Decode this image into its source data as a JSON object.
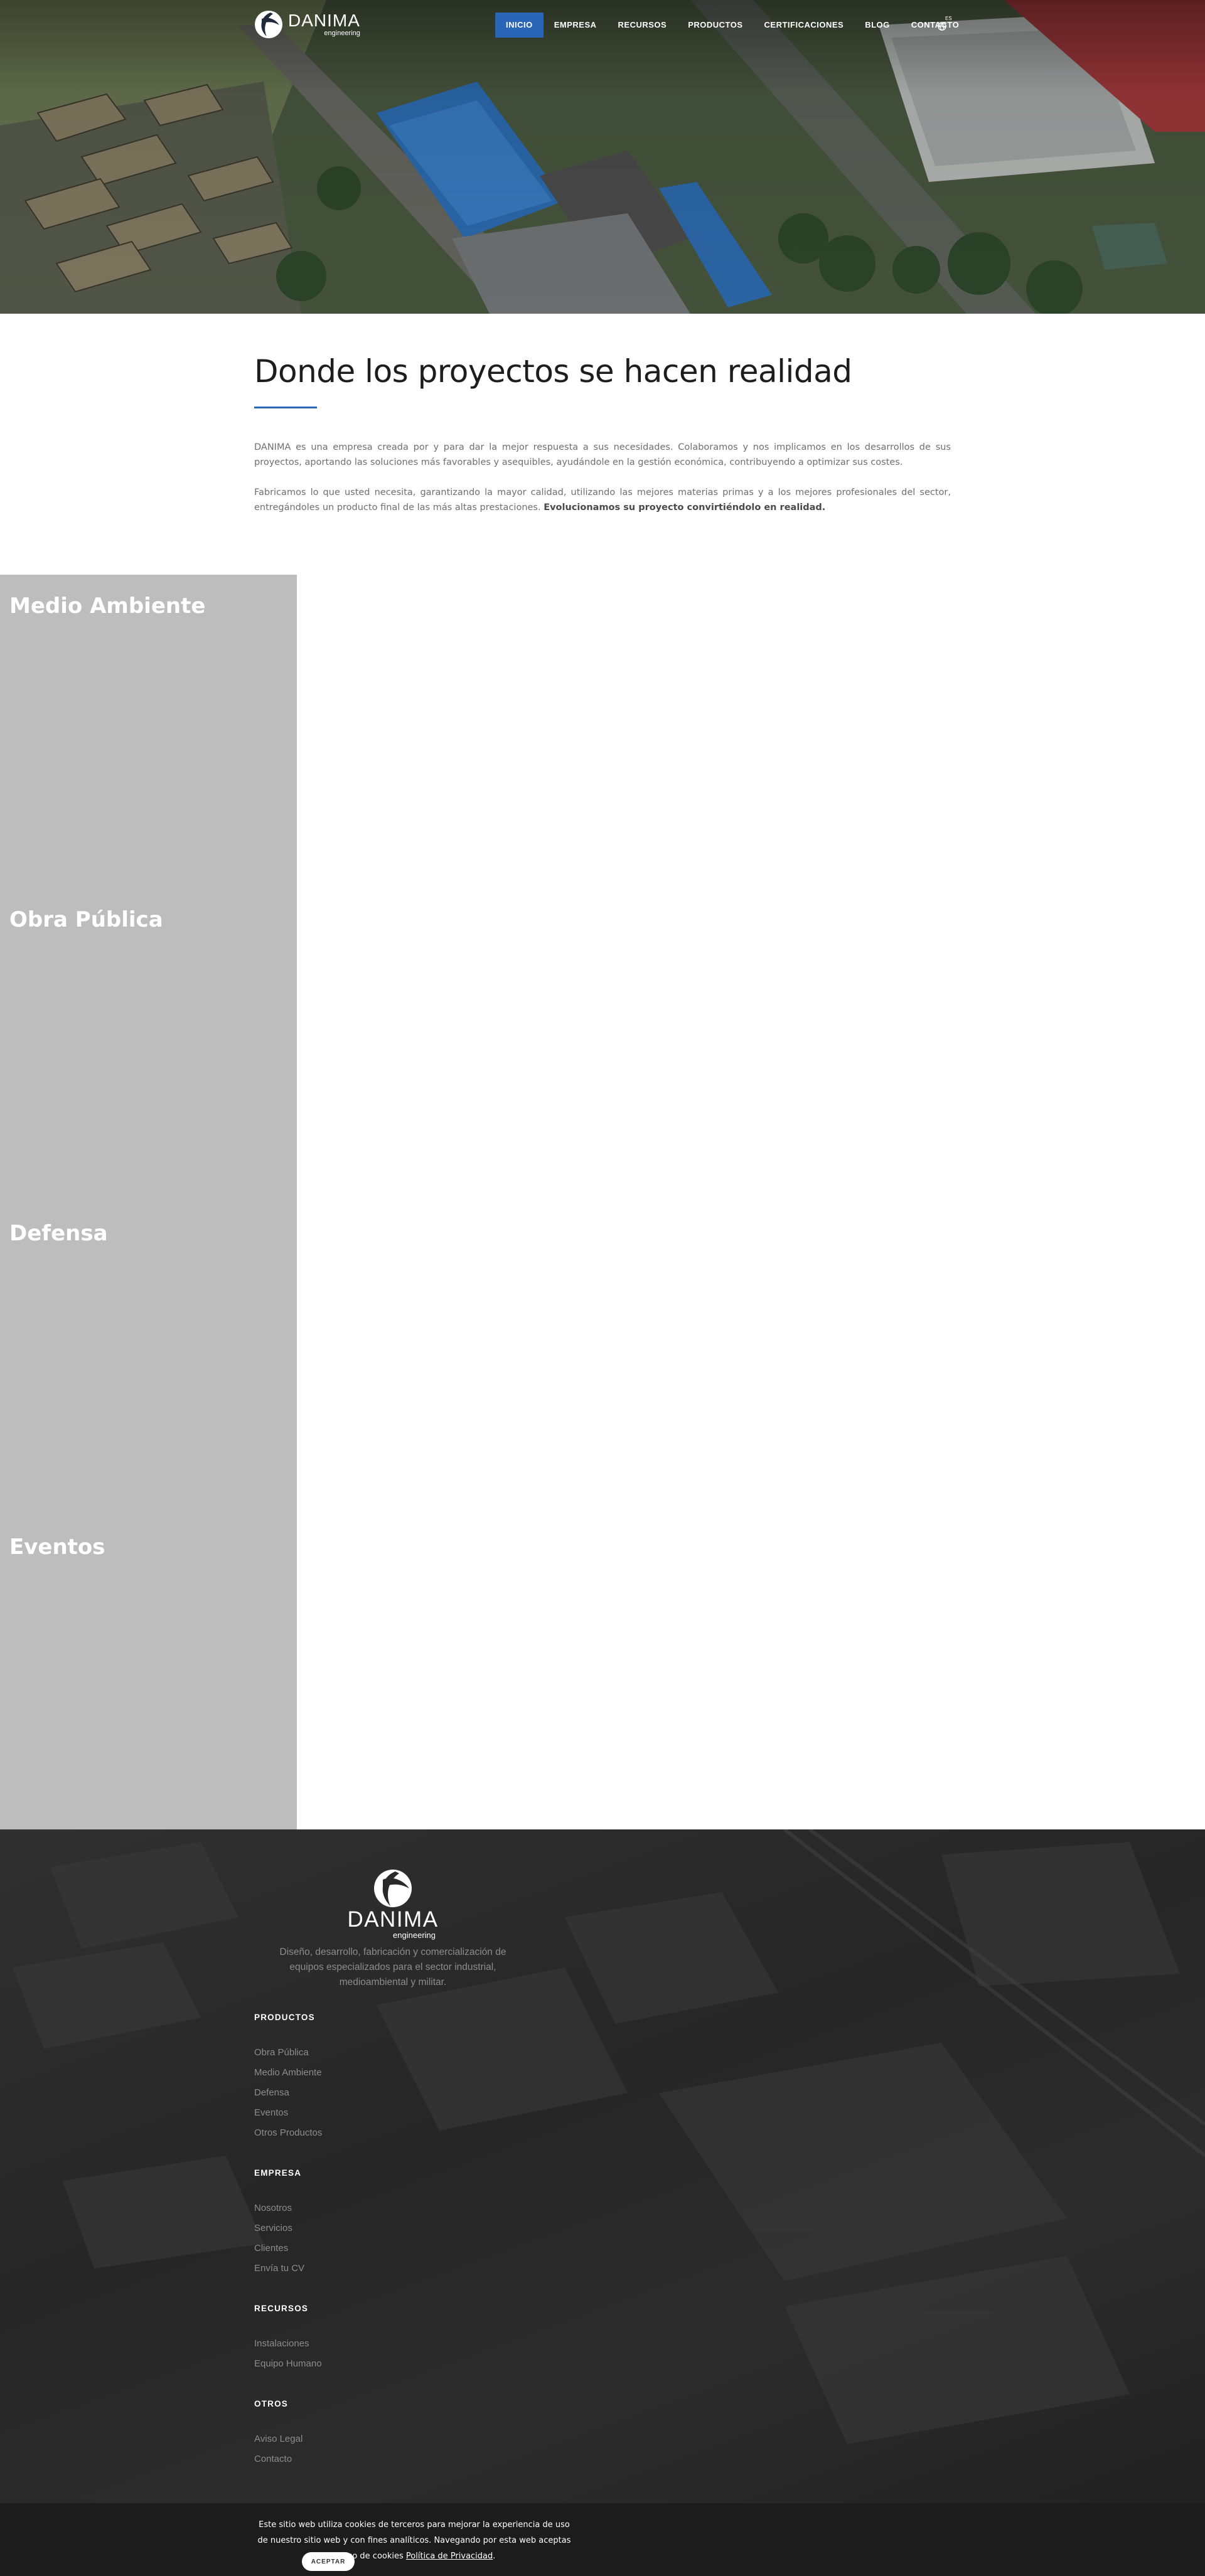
{
  "brand": {
    "name": "DANIMA",
    "sub": "engineering"
  },
  "nav": {
    "items": [
      {
        "label": "INICIO",
        "active": true
      },
      {
        "label": "EMPRESA",
        "active": false
      },
      {
        "label": "RECURSOS",
        "active": false
      },
      {
        "label": "PRODUCTOS",
        "active": false
      },
      {
        "label": "CERTIFICACIONES",
        "active": false
      },
      {
        "label": "BLOG",
        "active": false
      },
      {
        "label": "CONTACTO",
        "active": false
      }
    ],
    "lang_badge": "ES",
    "accent_color": "#2a66b7"
  },
  "intro": {
    "title": "Donde los proyectos se hacen realidad",
    "p1": "DANIMA es una empresa creada por y para dar la mejor respuesta a sus necesidades. Colaboramos y nos implicamos en los desarrollos de sus proyectos, aportando las soluciones más favorables y asequibles, ayudándole en la gestión económica, contribuyendo a optimizar sus costes.",
    "p2": "Fabricamos lo que usted necesita, garantizando la mayor calidad, utilizando las mejores materias primas y a los mejores profesionales del sector, entregándoles un producto final de las más altas prestaciones.",
    "p2_strong": "Evolucionamos su proyecto convirtiéndolo en realidad."
  },
  "sectors": [
    {
      "title": "Medio Ambiente"
    },
    {
      "title": "Obra Pública"
    },
    {
      "title": "Defensa"
    },
    {
      "title": "Eventos"
    }
  ],
  "footer": {
    "description": "Diseño, desarrollo, fabricación y comercialización de equipos especializados para el sector industrial, medioambiental y militar.",
    "productos": {
      "heading": "PRODUCTOS",
      "links": [
        "Obra Pública",
        "Medio Ambiente",
        "Defensa",
        "Eventos",
        "Otros Productos"
      ]
    },
    "empresa": {
      "heading": "EMPRESA",
      "links": [
        "Nosotros",
        "Servicios",
        "Clientes",
        "Envía tu CV"
      ]
    },
    "recursos": {
      "heading": "RECURSOS",
      "links": [
        "Instalaciones",
        "Equipo Humano"
      ]
    },
    "otros": {
      "heading": "OTROS",
      "links": [
        "Aviso Legal",
        "Contacto"
      ]
    }
  },
  "cookie": {
    "text": "Este sitio web utiliza cookies de terceros para mejorar la experiencia de uso de nuestro sitio web y con fines analíticos. Navegando por esta web aceptas el uso de cookies",
    "link_label": "Política de Privacidad",
    "button_label": "ACEPTAR"
  }
}
